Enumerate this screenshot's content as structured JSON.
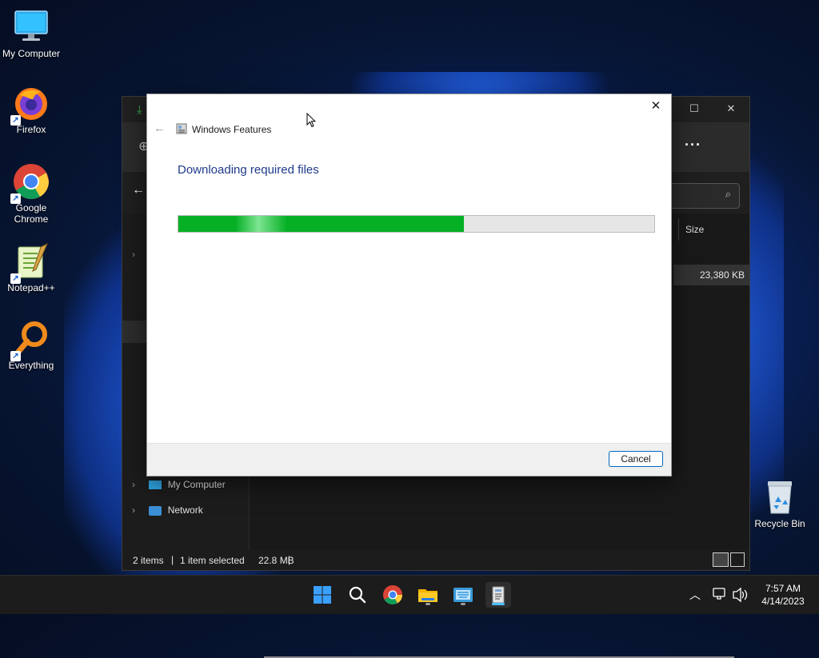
{
  "desktop": {
    "icons": [
      {
        "label": "My Computer"
      },
      {
        "label": "Firefox"
      },
      {
        "label": "Google Chrome"
      },
      {
        "label": "Notepad++"
      },
      {
        "label": "Everything"
      },
      {
        "label": "Recycle Bin"
      }
    ]
  },
  "explorer": {
    "column_size": "Size",
    "file_size": "23,380 KB",
    "nav": [
      {
        "label": "My Computer"
      },
      {
        "label": "Network"
      }
    ],
    "status": {
      "items": "2 items",
      "selected": "1 item selected",
      "size": "22.8 MB"
    }
  },
  "dialog": {
    "title": "Windows Features",
    "heading": "Downloading required files",
    "progress": 0.6,
    "cancel_label": "Cancel",
    "accent_color": "#06b025"
  },
  "taskbar": {
    "apps": [
      "start-icon",
      "search-icon",
      "chrome-icon",
      "file-explorer-icon",
      "keyboard-app-icon",
      "windows-features-icon"
    ],
    "time": "7:57 AM",
    "date": "4/14/2023"
  }
}
